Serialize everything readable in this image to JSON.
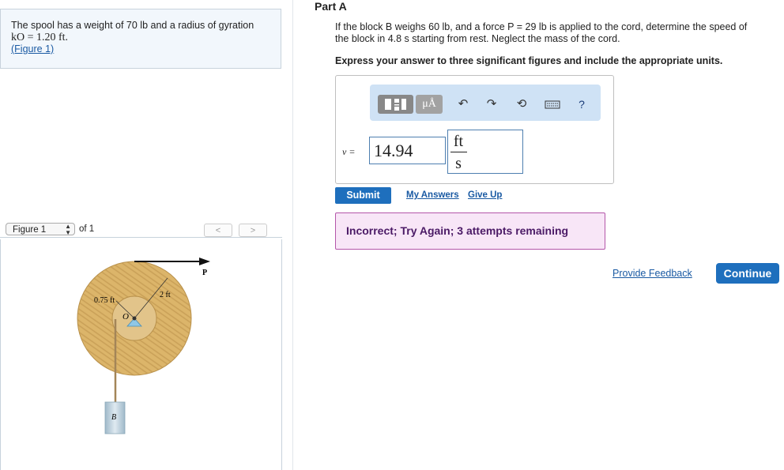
{
  "problem": {
    "text_line1": "The spool has a weight of 70 lb and a radius of gyration",
    "text_line2": "kO = 1.20 ft.",
    "figure_link": "(Figure 1)"
  },
  "figure_nav": {
    "selected": "Figure 1",
    "of_text": "of 1",
    "prev_label": "<",
    "next_label": ">"
  },
  "figure": {
    "label_outer_radius": "2 ft",
    "label_inner_radius": "0.75 ft",
    "label_center": "O",
    "label_force": "P",
    "label_block": "B"
  },
  "part": {
    "title": "Part A",
    "question_line1": "If the block B weighs 60 lb, and a force P = 29 lb is applied to the cord, determine the speed of",
    "question_line2": "the block in 4.8 s starting from rest. Neglect the mass of the cord.",
    "instruction": "Express your answer to three significant figures and include the appropriate units."
  },
  "toolbar": {
    "units_label": "μÅ",
    "help_label": "?"
  },
  "answer": {
    "variable_label": "v =",
    "value": "14.94",
    "unit_numerator": "ft",
    "unit_denominator": "s"
  },
  "actions": {
    "submit_label": "Submit",
    "my_answers_label": "My Answers",
    "give_up_label": "Give Up"
  },
  "feedback": {
    "message": "Incorrect; Try Again; 3 attempts remaining"
  },
  "footer": {
    "provide_feedback_label": "Provide Feedback",
    "continue_label": "Continue"
  },
  "colors": {
    "accent": "#1e6fbd",
    "feedback_bg": "#f8e6f7",
    "feedback_border": "#b456a9",
    "toolbar_bg": "#cfe2f5",
    "spool_wood": "#dcb56a"
  }
}
